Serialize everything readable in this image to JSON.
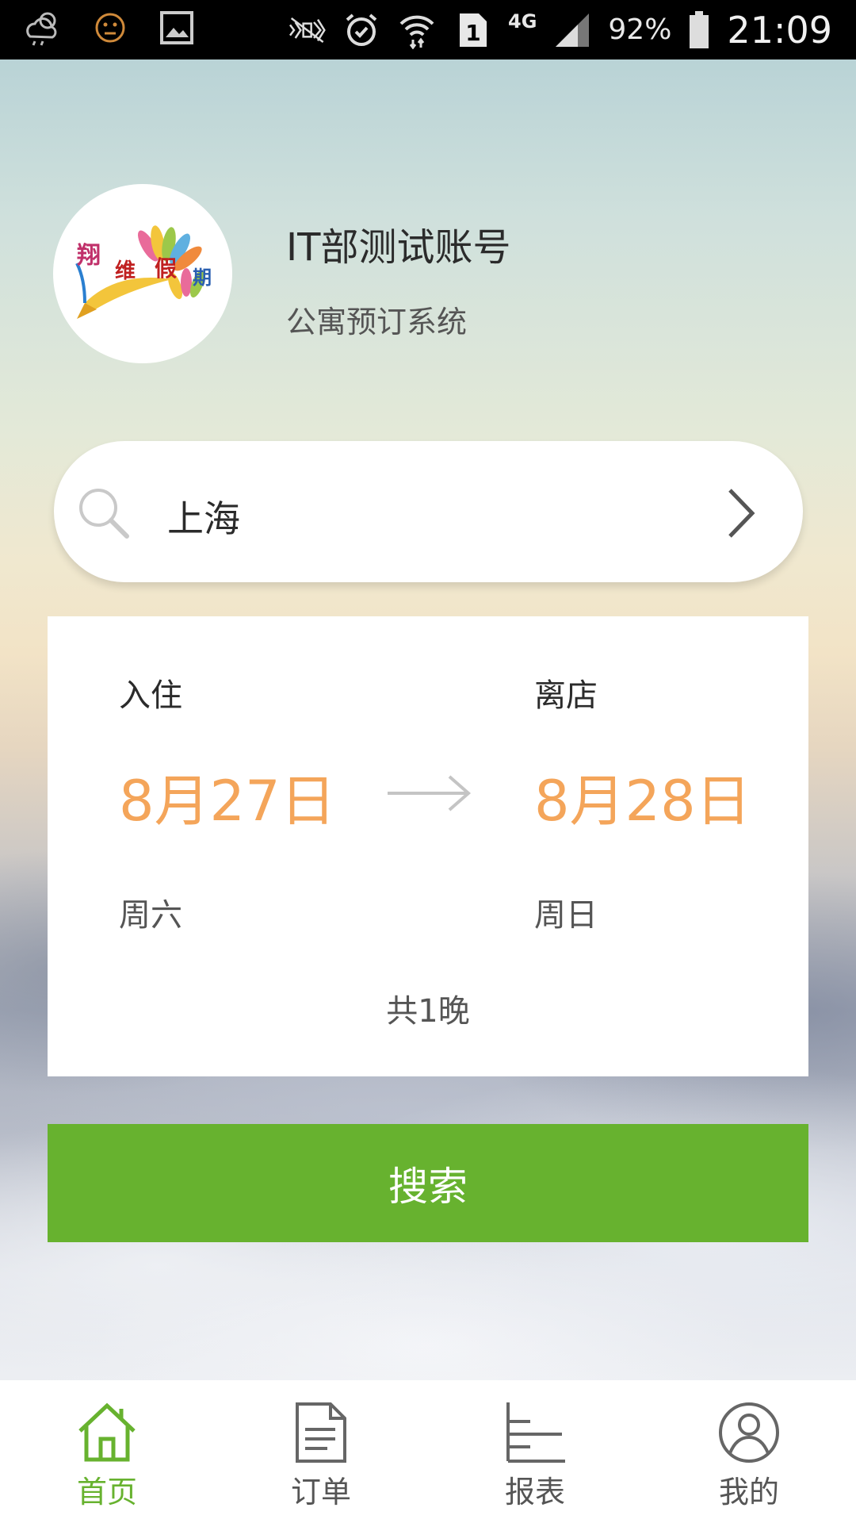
{
  "status_bar": {
    "left_icons": [
      "weather-icon",
      "emoji-icon",
      "image-icon"
    ],
    "right_icons": [
      "mute-icon",
      "alarm-icon",
      "wifi-icon",
      "sim-icon",
      "signal-icon",
      "battery-icon"
    ],
    "sim_slot": "1",
    "network": "4G",
    "battery": "92%",
    "time": "21:09"
  },
  "profile": {
    "logo_text": "翔维假期",
    "name": "IT部测试账号",
    "subtitle": "公寓预订系统"
  },
  "search": {
    "city": "上海"
  },
  "dates": {
    "checkin_label": "入住",
    "checkin_date": "8月27日",
    "checkin_weekday": "周六",
    "checkout_label": "离店",
    "checkout_date": "8月28日",
    "checkout_weekday": "周日",
    "nights": "共1晚"
  },
  "search_button": {
    "label": "搜索"
  },
  "nav": {
    "items": [
      {
        "label": "首页",
        "icon": "home-icon",
        "active": true
      },
      {
        "label": "订单",
        "icon": "document-icon",
        "active": false
      },
      {
        "label": "报表",
        "icon": "report-icon",
        "active": false
      },
      {
        "label": "我的",
        "icon": "user-icon",
        "active": false
      }
    ]
  },
  "colors": {
    "accent_green": "#67b22f",
    "date_orange": "#f4a55a"
  }
}
